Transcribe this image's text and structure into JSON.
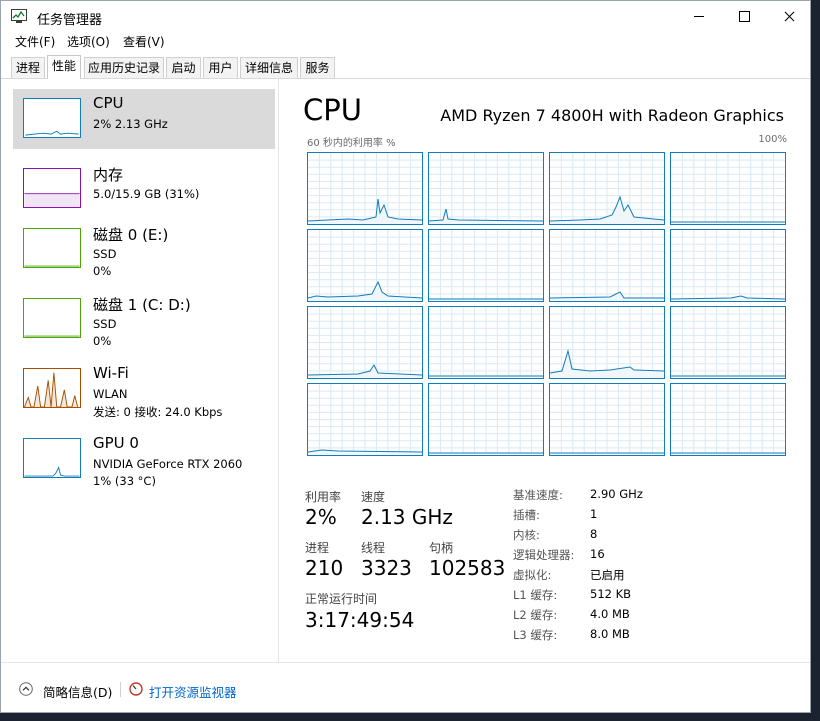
{
  "window": {
    "title": "任务管理器"
  },
  "menu": [
    "文件(F)",
    "选项(O)",
    "查看(V)"
  ],
  "tabs": [
    "进程",
    "性能",
    "应用历史记录",
    "启动",
    "用户",
    "详细信息",
    "服务"
  ],
  "sidebar": [
    {
      "title": "CPU",
      "lines": [
        "2% 2.13 GHz"
      ],
      "color": "#117dbb"
    },
    {
      "title": "内存",
      "lines": [
        "5.0/15.9 GB (31%)"
      ],
      "color": "#8b12ae"
    },
    {
      "title": "磁盘 0 (E:)",
      "lines": [
        "SSD",
        "0%"
      ],
      "color": "#4da60c"
    },
    {
      "title": "磁盘 1 (C: D:)",
      "lines": [
        "SSD",
        "0%"
      ],
      "color": "#4da60c"
    },
    {
      "title": "Wi-Fi",
      "lines": [
        "WLAN",
        "发送: 0 接收: 24.0 Kbps"
      ],
      "color": "#a74f01"
    },
    {
      "title": "GPU 0",
      "lines": [
        "NVIDIA GeForce RTX 2060",
        "1% (33 °C)"
      ],
      "color": "#117dbb"
    }
  ],
  "main": {
    "title": "CPU",
    "model": "AMD Ryzen 7 4800H with Radeon Graphics",
    "graph_label": "60 秒内的利用率 %",
    "graph_max": "100%",
    "stats": {
      "util_label": "利用率",
      "util_value": "2%",
      "speed_label": "速度",
      "speed_value": "2.13 GHz",
      "proc_label": "进程",
      "proc_value": "210",
      "thread_label": "线程",
      "thread_value": "3323",
      "handle_label": "句柄",
      "handle_value": "102583",
      "uptime_label": "正常运行时间",
      "uptime_value": "3:17:49:54"
    },
    "specs": [
      {
        "label": "基准速度:",
        "value": "2.90 GHz"
      },
      {
        "label": "插槽:",
        "value": "1"
      },
      {
        "label": "内核:",
        "value": "8"
      },
      {
        "label": "逻辑处理器:",
        "value": "16"
      },
      {
        "label": "虚拟化:",
        "value": "已启用"
      },
      {
        "label": "L1 缓存:",
        "value": "512 KB"
      },
      {
        "label": "L2 缓存:",
        "value": "4.0 MB"
      },
      {
        "label": "L3 缓存:",
        "value": "8.0 MB"
      }
    ]
  },
  "footer": {
    "fewer_details": "简略信息(D)",
    "open_monitor": "打开资源监视器"
  },
  "colors": {
    "cpu": "#117dbb",
    "memory": "#8b12ae",
    "disk": "#4da60c",
    "wifi": "#a74f01",
    "link": "#0066cc"
  },
  "icons": [
    "task-manager-icon",
    "chevron-up-icon",
    "resource-monitor-icon"
  ]
}
